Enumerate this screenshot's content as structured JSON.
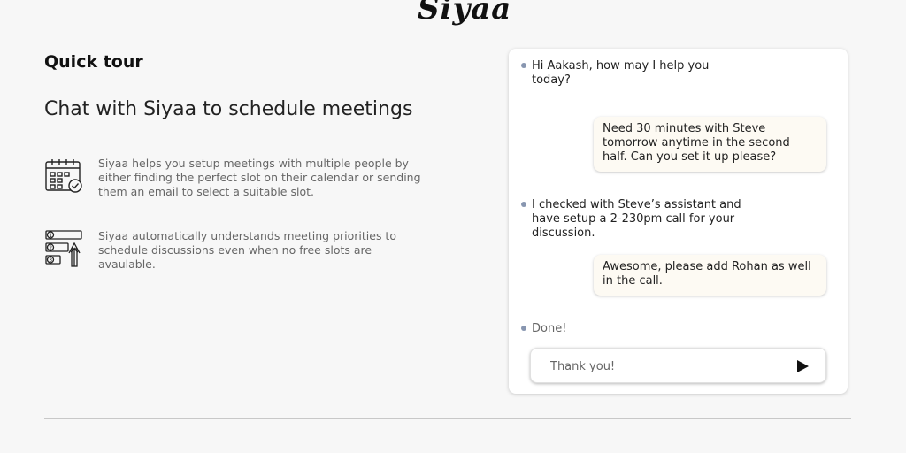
{
  "brand": {
    "logo": "Siyaa"
  },
  "tour": {
    "heading": "Quick tour",
    "subheading": "Chat with Siyaa to schedule meetings",
    "features": [
      {
        "icon": "calendar-check-icon",
        "text": "Siyaa helps you setup meetings with multiple people by either finding the perfect slot on their calendar or sending them an email to select a suitable slot."
      },
      {
        "icon": "priority-list-icon",
        "text": "Siyaa automatically understands meeting priorities to schedule discussions even when no free slots are avaulable."
      }
    ]
  },
  "chat": {
    "messages": [
      {
        "from": "bot",
        "text": "Hi Aakash, how may I help you today?"
      },
      {
        "from": "user",
        "text": "Need 30 minutes with Steve tomorrow anytime in the second half. Can you set it up please?"
      },
      {
        "from": "bot",
        "text": "I checked with Steve’s assistant and have setup a 2-230pm call for your discussion."
      },
      {
        "from": "user",
        "text": "Awesome, please add Rohan as well in the call."
      },
      {
        "from": "bot",
        "text": "Done!"
      }
    ],
    "input": {
      "value": "Thank you!",
      "send_icon": "send-icon"
    }
  },
  "colors": {
    "bot_dot": "#8896b0",
    "user_bubble": "#fdfaf3",
    "background": "#f7f7f7"
  }
}
